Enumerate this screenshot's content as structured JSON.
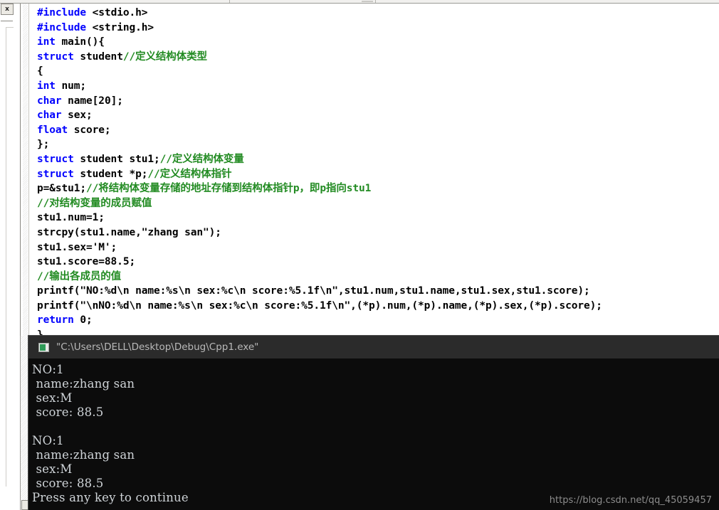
{
  "editor": {
    "close_button_label": "x",
    "language": "c",
    "lines": [
      {
        "indent": 0,
        "tokens": [
          {
            "t": "kw",
            "v": "#include"
          },
          {
            "t": "plain",
            "v": " <stdio.h>"
          }
        ]
      },
      {
        "indent": 0,
        "tokens": [
          {
            "t": "kw",
            "v": "#include"
          },
          {
            "t": "plain",
            "v": " <string.h>"
          }
        ]
      },
      {
        "indent": 0,
        "tokens": [
          {
            "t": "kw",
            "v": "int"
          },
          {
            "t": "plain",
            "v": " main(){"
          }
        ]
      },
      {
        "indent": 0,
        "tokens": [
          {
            "t": "kw",
            "v": "struct"
          },
          {
            "t": "plain",
            "v": " student"
          },
          {
            "t": "cmt",
            "v": "//定义结构体类型"
          }
        ]
      },
      {
        "indent": 0,
        "tokens": [
          {
            "t": "plain",
            "v": "{"
          }
        ]
      },
      {
        "indent": 0,
        "tokens": [
          {
            "t": "kw",
            "v": "int"
          },
          {
            "t": "plain",
            "v": " num;"
          }
        ]
      },
      {
        "indent": 0,
        "tokens": [
          {
            "t": "kw",
            "v": "char"
          },
          {
            "t": "plain",
            "v": " name[20];"
          }
        ]
      },
      {
        "indent": 0,
        "tokens": [
          {
            "t": "kw",
            "v": "char"
          },
          {
            "t": "plain",
            "v": " sex;"
          }
        ]
      },
      {
        "indent": 0,
        "tokens": [
          {
            "t": "kw",
            "v": "float"
          },
          {
            "t": "plain",
            "v": " score;"
          }
        ]
      },
      {
        "indent": 0,
        "tokens": [
          {
            "t": "plain",
            "v": "};"
          }
        ]
      },
      {
        "indent": 0,
        "tokens": [
          {
            "t": "kw",
            "v": "struct"
          },
          {
            "t": "plain",
            "v": " student stu1;"
          },
          {
            "t": "cmt",
            "v": "//定义结构体变量"
          }
        ]
      },
      {
        "indent": 0,
        "tokens": [
          {
            "t": "kw",
            "v": "struct"
          },
          {
            "t": "plain",
            "v": " student *p;"
          },
          {
            "t": "cmt",
            "v": "//定义结构体指针"
          }
        ]
      },
      {
        "indent": 0,
        "tokens": [
          {
            "t": "plain",
            "v": "p=&stu1;"
          },
          {
            "t": "cmt",
            "v": "//将结构体变量存储的地址存储到结构体指针p，即p指向stu1"
          }
        ]
      },
      {
        "indent": 0,
        "tokens": [
          {
            "t": "cmt",
            "v": "//对结构变量的成员赋值"
          }
        ]
      },
      {
        "indent": 0,
        "tokens": [
          {
            "t": "plain",
            "v": "stu1.num=1;"
          }
        ]
      },
      {
        "indent": 0,
        "tokens": [
          {
            "t": "plain",
            "v": "strcpy(stu1.name,\"zhang san\");"
          }
        ]
      },
      {
        "indent": 0,
        "tokens": [
          {
            "t": "plain",
            "v": "stu1.sex='M';"
          }
        ]
      },
      {
        "indent": 0,
        "tokens": [
          {
            "t": "plain",
            "v": "stu1.score=88.5;"
          }
        ]
      },
      {
        "indent": 0,
        "tokens": [
          {
            "t": "cmt",
            "v": "//输出各成员的值"
          }
        ]
      },
      {
        "indent": 0,
        "tokens": [
          {
            "t": "plain",
            "v": "printf(\"NO:%d\\n name:%s\\n sex:%c\\n score:%5.1f\\n\",stu1.num,stu1.name,stu1.sex,stu1.score);"
          }
        ]
      },
      {
        "indent": 0,
        "tokens": [
          {
            "t": "plain",
            "v": "printf(\"\\nNO:%d\\n name:%s\\n sex:%c\\n score:%5.1f\\n\",(*p).num,(*p).name,(*p).sex,(*p).score);"
          }
        ]
      },
      {
        "indent": 0,
        "tokens": [
          {
            "t": "kw",
            "v": "return"
          },
          {
            "t": "plain",
            "v": " 0;"
          }
        ]
      },
      {
        "indent": 0,
        "tokens": [
          {
            "t": "plain",
            "v": "}"
          }
        ]
      }
    ]
  },
  "console": {
    "title": "\"C:\\Users\\DELL\\Desktop\\Debug\\Cpp1.exe\"",
    "icon": "console-app-icon",
    "output_lines": [
      "NO:1",
      " name:zhang san",
      " sex:M",
      " score: 88.5",
      "",
      "NO:1",
      " name:zhang san",
      " sex:M",
      " score: 88.5",
      "Press any key to continue"
    ]
  },
  "watermark": {
    "text": "https://blog.csdn.net/qq_45059457"
  },
  "colors": {
    "keyword": "#0000ff",
    "comment": "#228b22",
    "code_text": "#000000",
    "editor_bg": "#ffffff",
    "console_bg": "#0c0c0c",
    "console_titlebar": "#2b2b2b",
    "console_text": "#cfd4d8",
    "console_title_text": "#b9b9b9",
    "watermark": "#8d8d8d"
  }
}
